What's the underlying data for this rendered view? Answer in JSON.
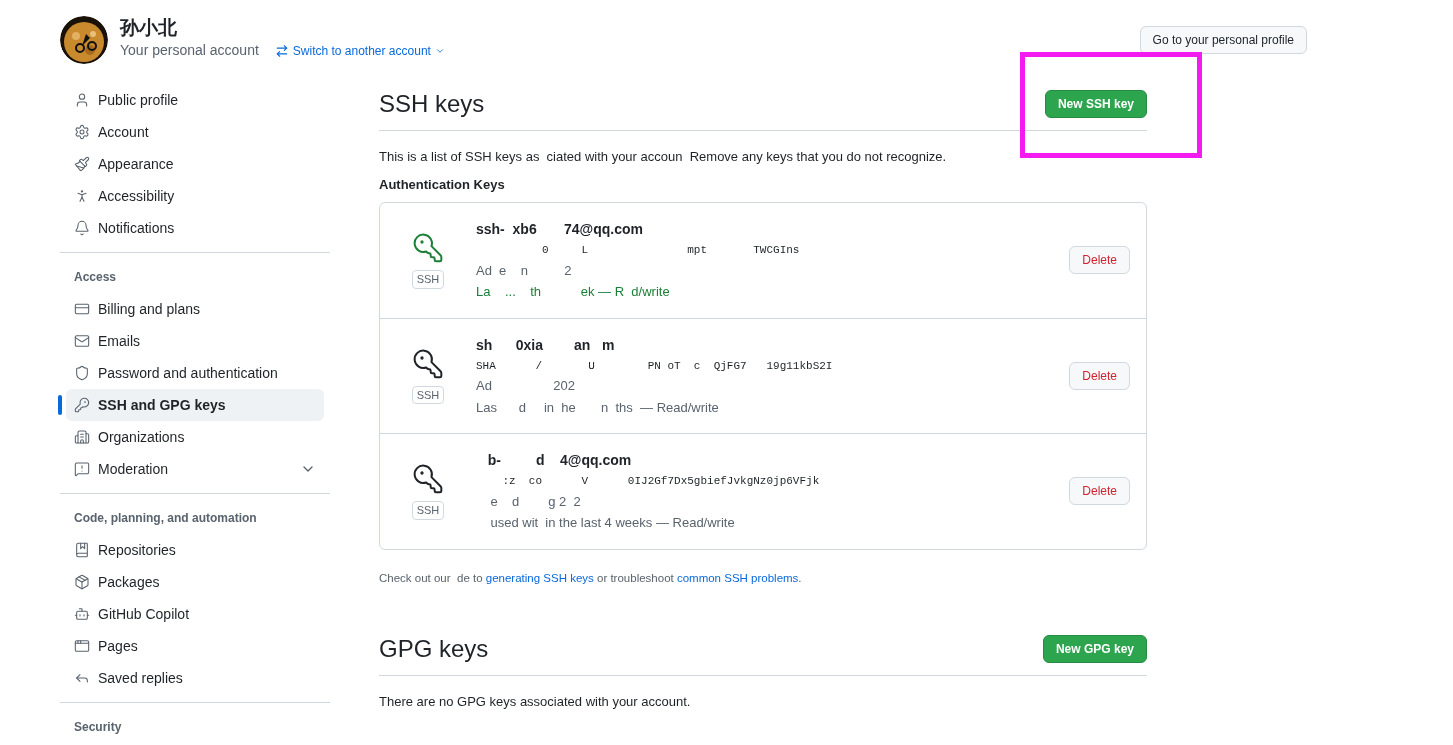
{
  "account": {
    "name": "孙小北",
    "subtitle": "Your personal account",
    "switch_label": "Switch to another account",
    "profile_button": "Go to your personal profile"
  },
  "sidebar": {
    "sections": [
      {
        "items": [
          {
            "label": "Public profile",
            "selected": false
          },
          {
            "label": "Account",
            "selected": false
          },
          {
            "label": "Appearance",
            "selected": false
          },
          {
            "label": "Accessibility",
            "selected": false
          },
          {
            "label": "Notifications",
            "selected": false
          }
        ]
      },
      {
        "heading": "Access",
        "items": [
          {
            "label": "Billing and plans",
            "selected": false
          },
          {
            "label": "Emails",
            "selected": false
          },
          {
            "label": "Password and authentication",
            "selected": false
          },
          {
            "label": "SSH and GPG keys",
            "selected": true
          },
          {
            "label": "Organizations",
            "selected": false
          },
          {
            "label": "Moderation",
            "selected": false,
            "expandable": true
          }
        ]
      },
      {
        "heading": "Code, planning, and automation",
        "items": [
          {
            "label": "Repositories",
            "selected": false
          },
          {
            "label": "Packages",
            "selected": false
          },
          {
            "label": "GitHub Copilot",
            "selected": false
          },
          {
            "label": "Pages",
            "selected": false
          },
          {
            "label": "Saved replies",
            "selected": false
          }
        ]
      },
      {
        "heading": "Security"
      }
    ]
  },
  "ssh": {
    "title": "SSH keys",
    "new_button": "New SSH key",
    "highlighted": true,
    "description": "This is a list of SSH keys as  ciated with your accoun  Remove any keys that you do not recognize.",
    "group_title": "Authentication Keys",
    "keys": [
      {
        "title": "ssh-  xb6       74@qq.com",
        "fingerprint": "          0     L               mpt       TWCGIns",
        "added": "Ad  e    n          2",
        "last_used": "La    ...    th           ek — R  d/write",
        "badge": "SSH",
        "recent": true,
        "delete": "Delete"
      },
      {
        "title": "sh      0xia        an   m",
        "fingerprint": "SHA      /       U        PN oT  c  QjFG7   19g11kbS2I",
        "added": "Ad                 202",
        "last_used": "Las      d     in  he       n  ths  — Read/write",
        "badge": "SSH",
        "recent": false,
        "delete": "Delete"
      },
      {
        "title": "   b-         d    4@qq.com",
        "fingerprint": "    :z  co      V      0IJ2Gf7Dx5gbiefJvkgNz0jp6VFjk",
        "added": "    e    d        g 2  2",
        "last_used": "    used wit  in the last 4 weeks — Read/write",
        "badge": "SSH",
        "recent": false,
        "delete": "Delete"
      }
    ],
    "help": {
      "before": "Check out our  de to ",
      "link1": "generating SSH keys",
      "middle": " or troubleshoot ",
      "link2": "common SSH problems",
      "after": "."
    }
  },
  "gpg": {
    "title": "GPG keys",
    "new_button": "New GPG key",
    "empty": "There are no GPG keys associated with your account."
  }
}
